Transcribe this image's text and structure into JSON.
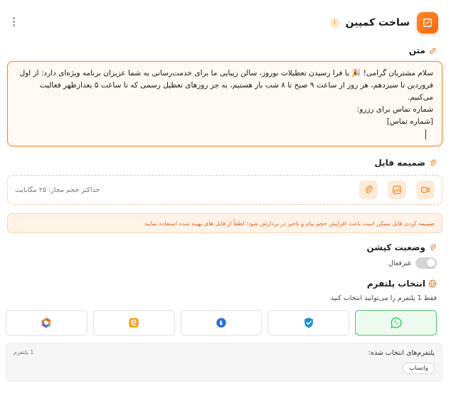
{
  "header": {
    "title": "ساخت کمپین",
    "icon": "pencil-icon",
    "accent": "#f06a10"
  },
  "text_section": {
    "label": "متن"
  },
  "message": {
    "lines": [
      "سلام مشتریان گرامی! 🎉 با فرا رسیدن تعطیلات نوروز، سالن زیبایی ما برای خدمت‌رسانی به شما عزیزان برنامه ویژه‌ای دارد: از اول",
      "فروردین تا سیزدهم، هر روز از ساعت ۹ صبح تا ۸ شب باز هستیم، به جز روزهای تعطیل رسمی که تا ساعت ۵ بعدازظهر فعالیت",
      "می‌کنیم.",
      "شماره تماس برای رزرو:",
      "[شماره تماس]"
    ]
  },
  "attachment": {
    "label": "ضمیمه فایل",
    "hint": "حداکثر حجم مجاز: ۲۵ مگابایت",
    "warning": "ضمیمه کردن فایل ممکن است باعث افزایش حجم پیام و تاخیر در پردازش شود؛ لطفاً از فایل های بهینه شده استفاده نمایید"
  },
  "caption": {
    "label": "وضعیت کپشن",
    "toggle_label": "غیرفعال",
    "enabled": false
  },
  "platform": {
    "label": "انتخاب پلتفرم",
    "hint": "فقط 1 پلتفرم را می‌توانید انتخاب کنید",
    "options": [
      "whatsapp",
      "bale",
      "soroush",
      "eitaa",
      "rubika"
    ],
    "selected_label": "پلتفرم‌های انتخاب شده:",
    "selected_count": "1 پلتفرم",
    "selected_chip": "واتساپ"
  }
}
